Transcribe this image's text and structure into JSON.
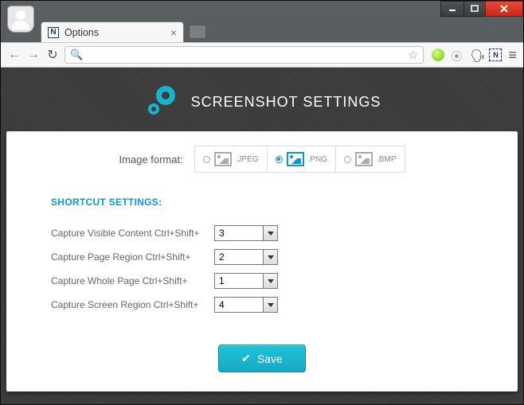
{
  "window": {
    "tab_title": "Options",
    "favicon_letter": "N"
  },
  "page": {
    "hero_title": "SCREENSHOT SETTINGS",
    "format_label": "Image format:",
    "formats": [
      {
        "label": ".JPEG",
        "selected": false
      },
      {
        "label": ".PNG",
        "selected": true
      },
      {
        "label": ".BMP",
        "selected": false
      }
    ],
    "section_heading": "SHORTCUT SETTINGS:",
    "shortcuts": [
      {
        "label": "Capture Visible Content Ctrl+Shift+",
        "value": "3"
      },
      {
        "label": "Capture Page Region Ctrl+Shift+",
        "value": "2"
      },
      {
        "label": "Capture Whole Page Ctrl+Shift+",
        "value": "1"
      },
      {
        "label": "Capture Screen Region Ctrl+Shift+",
        "value": "4"
      }
    ],
    "save_label": "Save"
  }
}
